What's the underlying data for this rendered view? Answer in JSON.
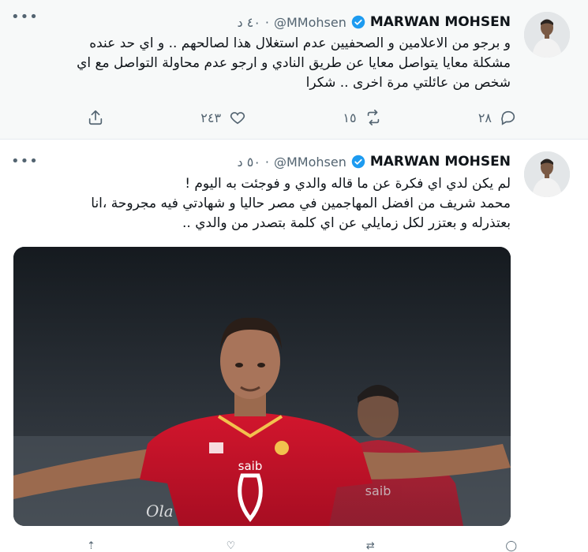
{
  "tweets": [
    {
      "author_name": "MARWAN MOHSEN",
      "handle": "@MMohsen",
      "time": "٤٠ د",
      "lines": [
        "و برجو من الاعلامين و الصحفيين عدم استغلال هذا لصالحهم .. و اي حد عنده",
        "مشكلة معايا يتواصل معايا عن طريق النادي  و ارجو عدم محاولة التواصل مع اي",
        "شخص من عائلتي مرة اخرى .. شكرا"
      ],
      "replies": "٢٨",
      "retweets": "١٥",
      "likes": "٢٤٣"
    },
    {
      "author_name": "MARWAN MOHSEN",
      "handle": "@MMohsen",
      "time": "٥٠ د",
      "lines": [
        "لم يكن لدي اي فكرة عن ما قاله والدي و فوجئت به اليوم !",
        "محمد شريف من افضل المهاجمين في مصر حاليا و شهادتي فيه مجروحة ،انا",
        "بعتذرله و بعتزر لكل زمايلي عن اي كلمة بتصدر من والدي .."
      ],
      "media": {
        "jersey_sponsor": "saib",
        "watermark": "Ola"
      }
    }
  ],
  "colors": {
    "verified_blue": "#1d9bf0",
    "jersey_red": "#c8102e",
    "muted": "#536471"
  }
}
